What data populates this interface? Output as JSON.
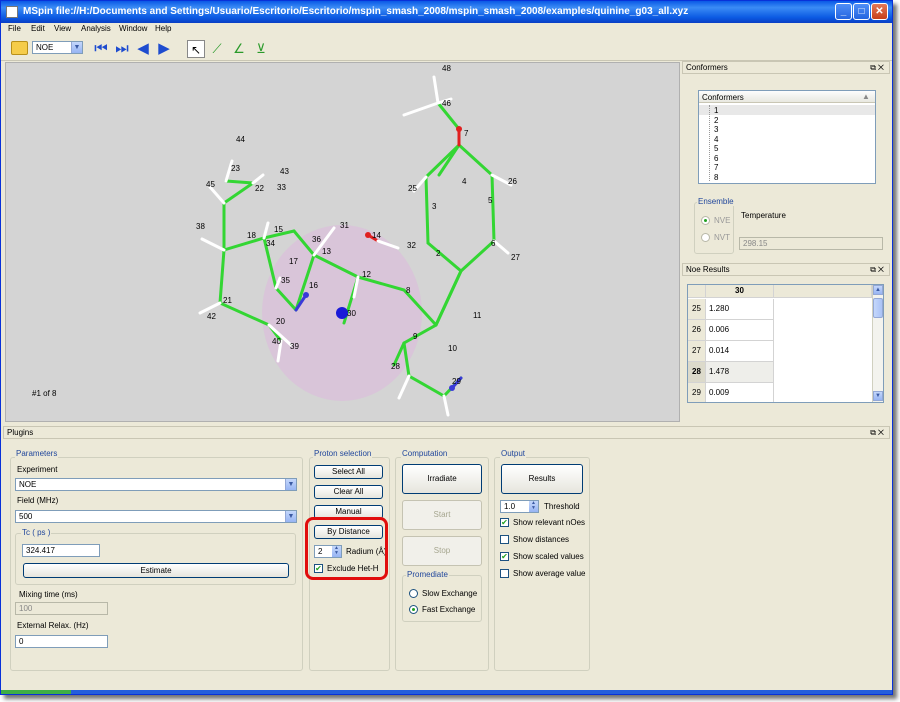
{
  "window": {
    "title": "MSpin file://H:/Documents and Settings/Usuario/Escritorio/Escritorio/mspin_smash_2008/mspin_smash_2008/examples/quinine_g03_all.xyz",
    "buttons": {
      "minimize": "_",
      "maximize": "□",
      "close": "✕"
    }
  },
  "menu": [
    "File",
    "Edit",
    "View",
    "Analysis",
    "Window",
    "Help"
  ],
  "toolbar": {
    "mode_selected": "NOE"
  },
  "viewer": {
    "conformer_status": "#1 of 8",
    "atom_labels": [
      "48",
      "46",
      "7",
      "4",
      "26",
      "25",
      "3",
      "5",
      "6",
      "27",
      "2",
      "14",
      "32",
      "31",
      "36",
      "12",
      "44",
      "43",
      "45",
      "23",
      "22",
      "33",
      "15",
      "13",
      "18",
      "34",
      "38",
      "17",
      "35",
      "16",
      "21",
      "42",
      "20",
      "40",
      "39",
      "30",
      "8",
      "11",
      "9",
      "10",
      "28",
      "29"
    ],
    "colors": {
      "background": "#d4d4d4",
      "carbon": "#33d633",
      "hydrogen": "#ffffff",
      "nitrogen": "#3a3ad8",
      "oxygen": "#e02020",
      "selected_atom": "#1a1ad8",
      "sphere": "#d8bfd8"
    }
  },
  "conformers_dock": {
    "title": "Conformers",
    "list_header": "Conformers",
    "items": [
      "1",
      "2",
      "3",
      "4",
      "5",
      "6",
      "7",
      "8"
    ],
    "ensemble": {
      "title": "Ensemble",
      "options": [
        "NVE",
        "NVT"
      ],
      "temperature_label": "Temperature",
      "temperature_value": "298.15"
    }
  },
  "noe_dock": {
    "title": "Noe Results",
    "column_header": "30",
    "rows": [
      {
        "index": "25",
        "value": "1.280"
      },
      {
        "index": "26",
        "value": "0.006"
      },
      {
        "index": "27",
        "value": "0.014"
      },
      {
        "index": "28",
        "value": "1.478"
      },
      {
        "index": "29",
        "value": "0.009"
      }
    ]
  },
  "plugins": {
    "title": "Plugins",
    "parameters": {
      "title": "Parameters",
      "experiment_label": "Experiment",
      "experiment_value": "NOE",
      "field_label": "Field (MHz)",
      "field_value": "500",
      "tc_title": "Tc ( ps )",
      "tc_value": "324.417",
      "estimate_label": "Estimate",
      "mixing_label": "Mixing time (ms)",
      "mixing_value": "100",
      "relax_label": "External Relax. (Hz)",
      "relax_value": "0"
    },
    "proton_selection": {
      "title": "Proton selection",
      "select_all": "Select All",
      "clear_all": "Clear All",
      "manual": "Manual",
      "by_distance": "By Distance",
      "radius_value": "2",
      "radius_label": "Radium (Å)",
      "exclude_label": "Exclude Het-H"
    },
    "computation": {
      "title": "Computation",
      "irradiate": "Irradiate",
      "start": "Start",
      "stop": "Stop",
      "promediate_title": "Promediate",
      "slow": "Slow Exchange",
      "fast": "Fast Exchange"
    },
    "output": {
      "title": "Output",
      "results": "Results",
      "threshold_value": "1.0",
      "threshold_label": "Threshold",
      "opt_relevant": "Show relevant nOes",
      "opt_distances": "Show distances",
      "opt_scaled": "Show scaled values",
      "opt_average": "Show average value"
    }
  }
}
